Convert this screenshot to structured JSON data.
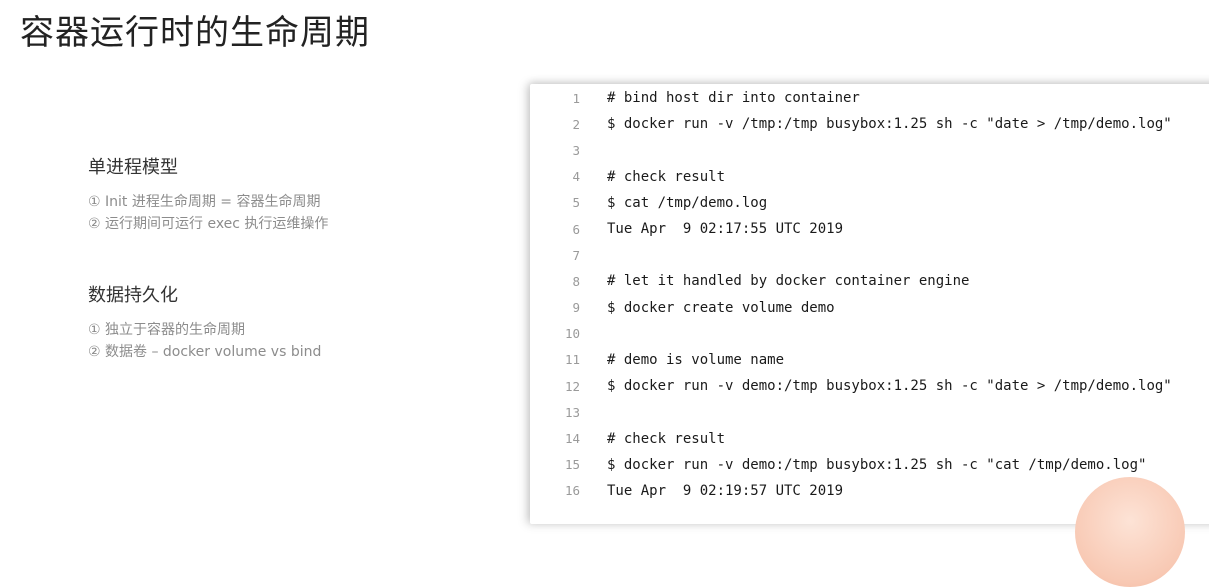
{
  "title": "容器运行时的生命周期",
  "sections": [
    {
      "heading": "单进程模型",
      "items": [
        "① Init 进程生命周期 = 容器生命周期",
        "② 运行期间可运行 exec 执行运维操作"
      ]
    },
    {
      "heading": "数据持久化",
      "items": [
        "① 独立于容器的生命周期",
        "② 数据卷 – docker volume vs bind"
      ]
    }
  ],
  "code": {
    "lines": [
      {
        "num": "1",
        "text": "# bind host dir into container"
      },
      {
        "num": "2",
        "text": "$ docker run -v /tmp:/tmp busybox:1.25 sh -c \"date > /tmp/demo.log\""
      },
      {
        "num": "3",
        "text": ""
      },
      {
        "num": "4",
        "text": "# check result"
      },
      {
        "num": "5",
        "text": "$ cat /tmp/demo.log"
      },
      {
        "num": "6",
        "text": "Tue Apr  9 02:17:55 UTC 2019"
      },
      {
        "num": "7",
        "text": ""
      },
      {
        "num": "8",
        "text": "# let it handled by docker container engine"
      },
      {
        "num": "9",
        "text": "$ docker create volume demo"
      },
      {
        "num": "10",
        "text": ""
      },
      {
        "num": "11",
        "text": "# demo is volume name"
      },
      {
        "num": "12",
        "text": "$ docker run -v demo:/tmp busybox:1.25 sh -c \"date > /tmp/demo.log\""
      },
      {
        "num": "13",
        "text": ""
      },
      {
        "num": "14",
        "text": "# check result"
      },
      {
        "num": "15",
        "text": "$ docker run -v demo:/tmp busybox:1.25 sh -c \"cat /tmp/demo.log\""
      },
      {
        "num": "16",
        "text": "Tue Apr  9 02:19:57 UTC 2019"
      }
    ]
  },
  "colors": {
    "title": "#222222",
    "heading": "#333333",
    "item": "#8c8c8c",
    "line_number": "#9a9a9a",
    "code_text": "#1a1a1a",
    "decor_circle": "#f8c9b4"
  }
}
